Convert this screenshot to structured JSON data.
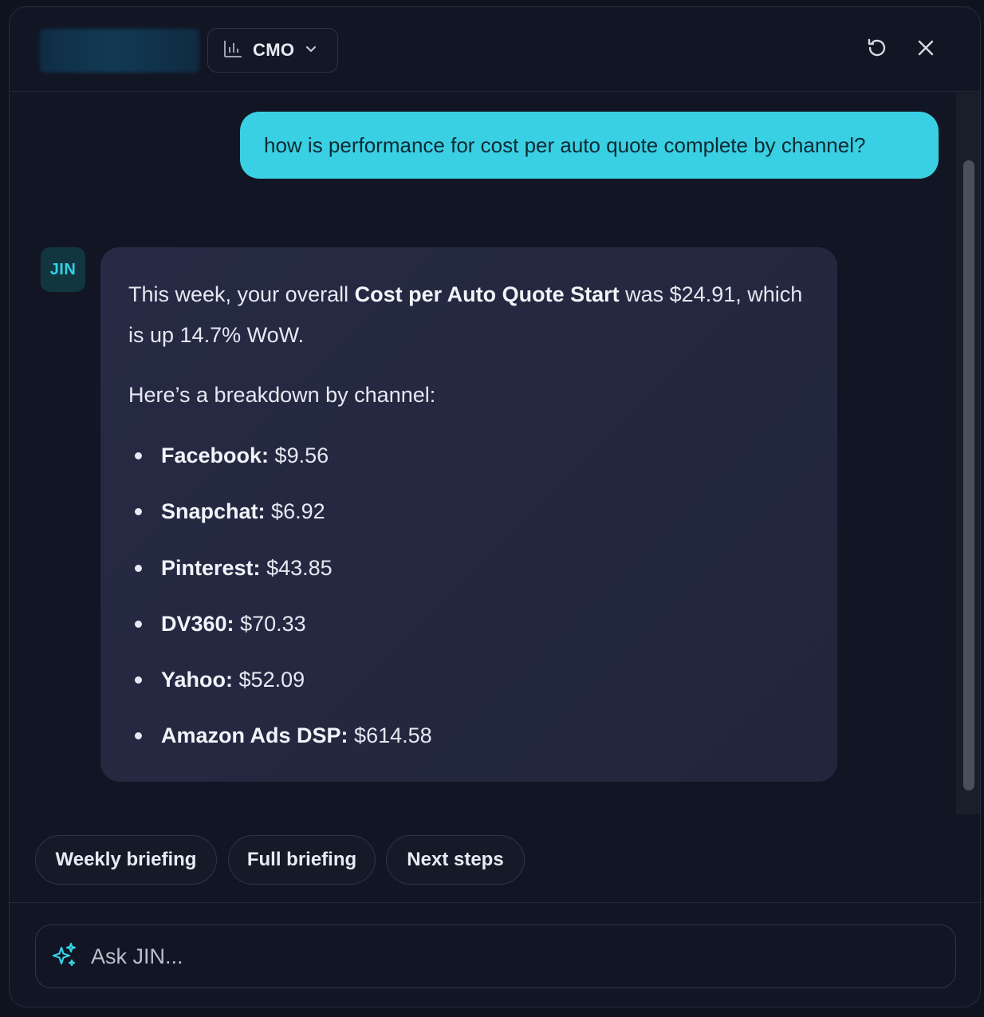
{
  "header": {
    "role_select": {
      "label": "CMO",
      "icon": "bar-chart-icon",
      "chevron": "chevron-down-icon"
    },
    "actions": [
      {
        "name": "refresh",
        "icon": "refresh-icon"
      },
      {
        "name": "close",
        "icon": "close-icon"
      }
    ]
  },
  "chat": {
    "user_message": "how is performance for cost per auto quote complete by channel?",
    "assistant": {
      "avatar_label": "JIN",
      "intro_prefix": "This week, your overall ",
      "intro_bold": "Cost per Auto Quote Start",
      "intro_suffix": " was $24.91, which is up 14.7% WoW.",
      "breakdown_heading": "Here’s a breakdown by channel:",
      "channels": [
        {
          "name": "Facebook:",
          "value": "$9.56"
        },
        {
          "name": "Snapchat:",
          "value": "$6.92"
        },
        {
          "name": "Pinterest:",
          "value": "$43.85"
        },
        {
          "name": "DV360:",
          "value": "$70.33"
        },
        {
          "name": "Yahoo:",
          "value": "$52.09"
        },
        {
          "name": "Amazon Ads DSP:",
          "value": "$614.58"
        }
      ]
    }
  },
  "suggestions": [
    "Weekly briefing",
    "Full briefing",
    "Next steps"
  ],
  "input": {
    "placeholder": "Ask JIN...",
    "value": "",
    "icon": "sparkle-icon"
  },
  "colors": {
    "accent": "#3ad0e3",
    "background": "#121624",
    "bubble": "#262a44"
  }
}
